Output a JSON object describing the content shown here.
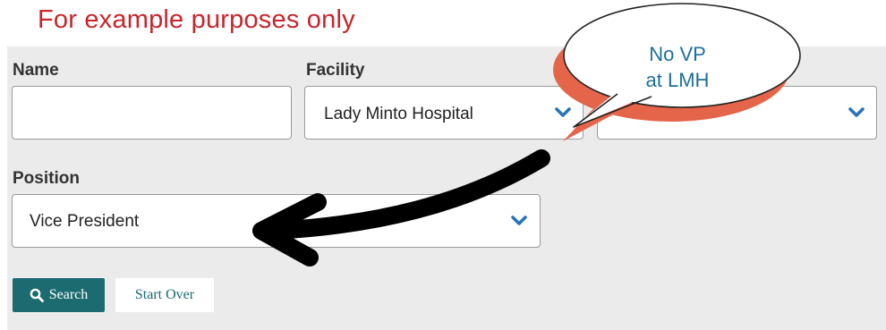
{
  "annotation": {
    "note": "For example purposes only",
    "bubble_line1": "No VP",
    "bubble_line2": "at LMH"
  },
  "form": {
    "name_label": "Name",
    "name_value": "",
    "facility_label": "Facility",
    "facility_value": "Lady Minto Hospital",
    "third_value": "",
    "position_label": "Position",
    "position_value": "Vice President",
    "search_label": "Search",
    "start_over_label": "Start Over"
  },
  "colors": {
    "note_red": "#c8252c",
    "accent_teal": "#1b6b70",
    "chevron_blue": "#2a73b8",
    "bubble_shadow": "#e5654a",
    "bubble_text": "#1e6f98"
  },
  "icons": [
    "search-icon",
    "chevron-down-icon",
    "speech-bubble",
    "curved-arrow"
  ]
}
